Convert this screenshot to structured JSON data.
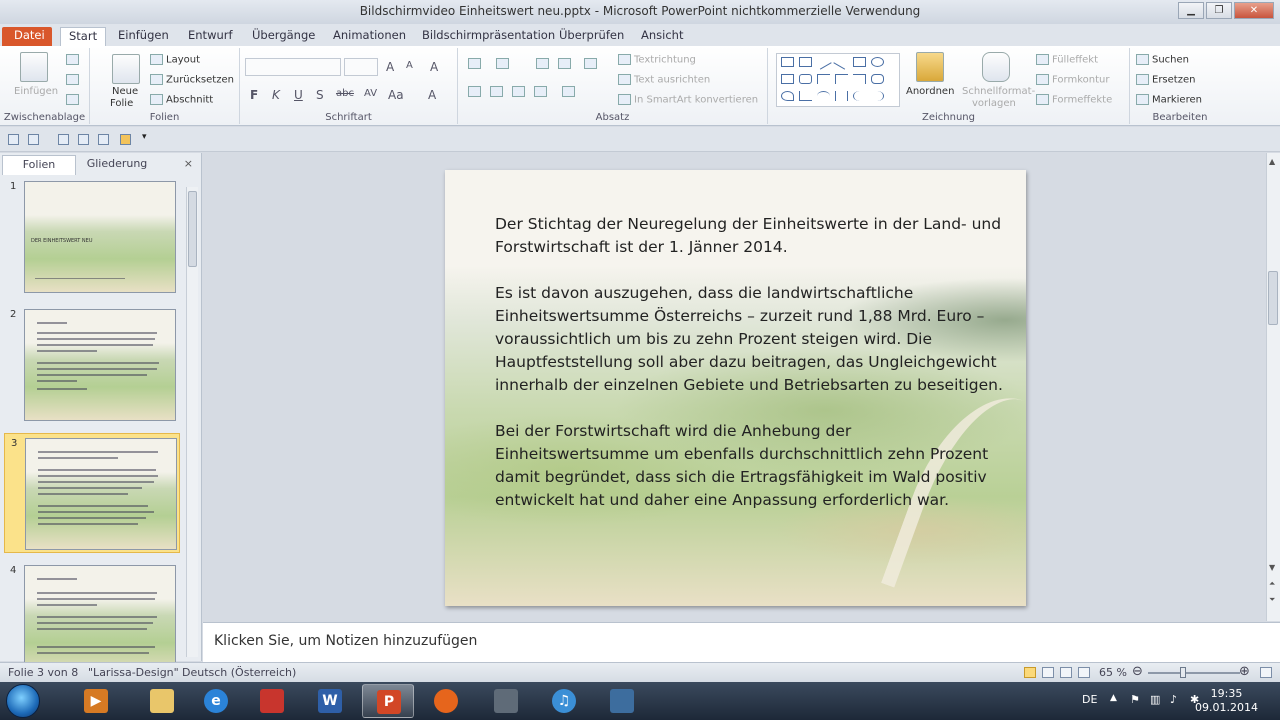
{
  "window": {
    "title": "Bildschirmvideo Einheitswert neu.pptx - Microsoft PowerPoint nichtkommerzielle Verwendung",
    "minimize": "▁",
    "maximize": "❐",
    "close": "✕"
  },
  "tabs": [
    {
      "label": "Datei"
    },
    {
      "label": "Start"
    },
    {
      "label": "Einfügen"
    },
    {
      "label": "Entwurf"
    },
    {
      "label": "Übergänge"
    },
    {
      "label": "Animationen"
    },
    {
      "label": "Bildschirmpräsentation"
    },
    {
      "label": "Überprüfen"
    },
    {
      "label": "Ansicht"
    }
  ],
  "ribbon": {
    "clipboard": {
      "label": "Zwischenablage",
      "paste": "Einfügen"
    },
    "slides": {
      "label": "Folien",
      "new_slide": "Neue",
      "new_slide_2": "Folie",
      "layout": "Layout",
      "reset": "Zurücksetzen",
      "section": "Abschnitt"
    },
    "font": {
      "label": "Schriftart",
      "bold": "F",
      "italic": "K",
      "underline": "U",
      "shadow": "S",
      "strike": "abc",
      "spacing": "AV",
      "case": "Aa",
      "grow": "A",
      "shrink": "A",
      "clear": "A",
      "color": "A"
    },
    "paragraph": {
      "label": "Absatz",
      "text_direction": "Textrichtung",
      "align_text": "Text ausrichten",
      "smartart": "In SmartArt konvertieren"
    },
    "drawing": {
      "label": "Zeichnung",
      "arrange": "Anordnen",
      "quick_styles": "Schnellformat-",
      "quick_styles_2": "vorlagen",
      "fill": "Fülleffekt",
      "outline": "Formkontur",
      "effects": "Formeffekte"
    },
    "editing": {
      "label": "Bearbeiten",
      "find": "Suchen",
      "replace": "Ersetzen",
      "select": "Markieren"
    }
  },
  "panel": {
    "tab_slides": "Folien",
    "tab_outline": "Gliederung",
    "close": "×",
    "thumbnails": [
      {
        "num": "1",
        "caption": "DER EINHEITSWERT NEU"
      },
      {
        "num": "2",
        "caption": ""
      },
      {
        "num": "3",
        "caption": ""
      },
      {
        "num": "4",
        "caption": ""
      }
    ]
  },
  "slide": {
    "paragraphs": [
      "Der Stichtag der Neuregelung der Einheitswerte in der Land- und Forstwirtschaft ist der 1. Jänner 2014.",
      "Es ist davon auszugehen, dass die landwirtschaftliche Einheitswertsumme Österreichs – zurzeit rund 1,88 Mrd. Euro – voraussichtlich um bis zu zehn Prozent steigen wird. Die Hauptfeststellung soll aber dazu beitragen, das Ungleichgewicht innerhalb der einzelnen Gebiete und Betriebsarten zu beseitigen.",
      "Bei der Forstwirtschaft wird die Anhebung der Einheitswertsumme um ebenfalls durchschnittlich zehn Prozent damit begründet, dass sich die Ertragsfähigkeit im Wald positiv entwickelt hat und daher eine Anpassung erforderlich war."
    ]
  },
  "notes": {
    "placeholder": "Klicken Sie, um Notizen hinzuzufügen"
  },
  "status": {
    "slide_count": "Folie 3 von 8",
    "theme": "\"Larissa-Design\"",
    "language": "Deutsch (Österreich)",
    "zoom": "65 %",
    "zoom_level": 0.38
  },
  "taskbar": {
    "language": "DE",
    "time": "19:35",
    "date": "09.01.2014"
  },
  "colors": {
    "file_tab": "#d9572b",
    "selected_thumb": "#fbe28a"
  }
}
